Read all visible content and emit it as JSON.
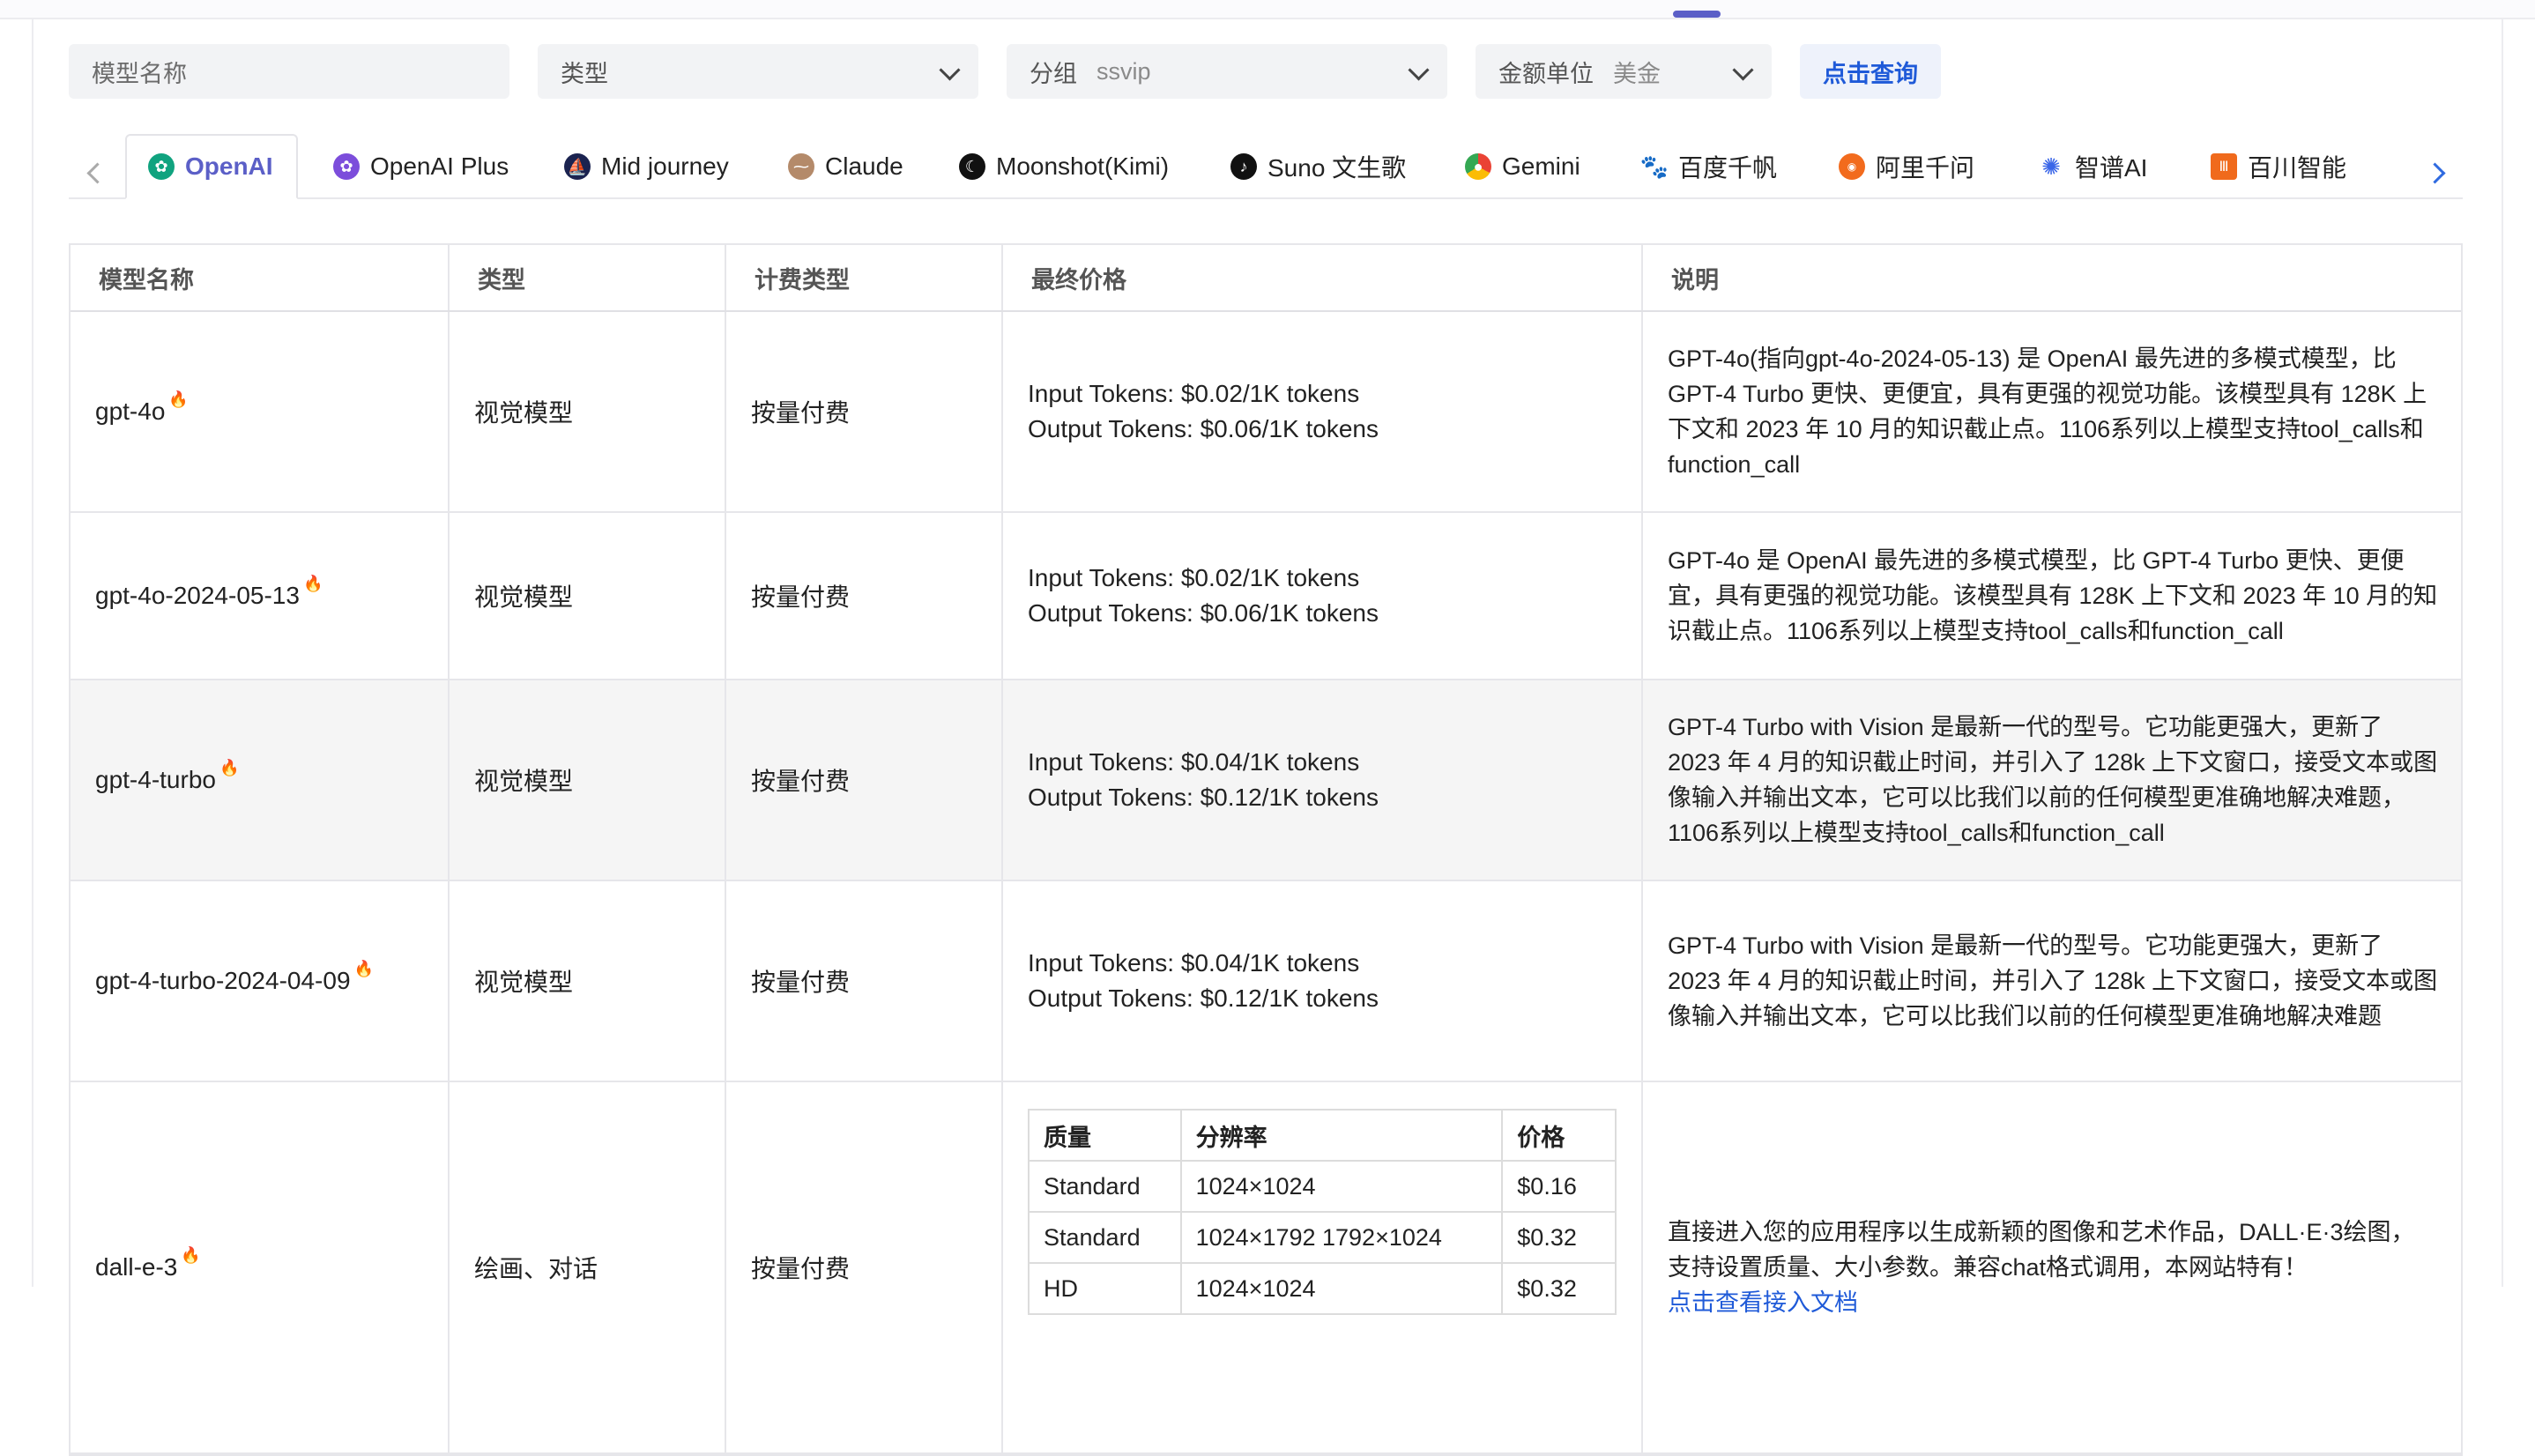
{
  "filters": {
    "model_name_placeholder": "模型名称",
    "type_label": "类型",
    "group_label": "分组",
    "group_value": "ssvip",
    "currency_label": "金额单位",
    "currency_value": "美金",
    "query_button": "点击查询"
  },
  "tabs": [
    {
      "label": "OpenAI",
      "icon": "openai-icon",
      "color": "#10a37f",
      "active": true
    },
    {
      "label": "OpenAI Plus",
      "icon": "openai-plus-icon",
      "color": "#7c4ddb"
    },
    {
      "label": "Mid journey",
      "icon": "midjourney-icon",
      "color": "#1b2350"
    },
    {
      "label": "Claude",
      "icon": "claude-icon",
      "color": "#b48a6a"
    },
    {
      "label": "Moonshot(Kimi)",
      "icon": "moonshot-icon",
      "color": "#111111"
    },
    {
      "label": "Suno 文生歌",
      "icon": "suno-icon",
      "color": "#111111"
    },
    {
      "label": "Gemini",
      "icon": "gemini-icon",
      "color": "#4285f4"
    },
    {
      "label": "百度千帆",
      "icon": "baidu-icon",
      "color": "#2f6ae0"
    },
    {
      "label": "阿里千问",
      "icon": "ali-icon",
      "color": "#f26b1d"
    },
    {
      "label": "智谱AI",
      "icon": "zhipu-icon",
      "color": "#3a66e8"
    },
    {
      "label": "百川智能",
      "icon": "baichuan-icon",
      "color": "#f06a1c"
    }
  ],
  "table": {
    "headers": [
      "模型名称",
      "类型",
      "计费类型",
      "最终价格",
      "说明"
    ],
    "rows": [
      {
        "name": "gpt-4o",
        "type": "视觉模型",
        "billing": "按量付费",
        "price_in": "Input Tokens: $0.02/1K tokens",
        "price_out": "Output Tokens: $0.06/1K tokens",
        "desc": "GPT-4o(指向gpt-4o-2024-05-13) 是 OpenAI 最先进的多模式模型，比 GPT-4 Turbo 更快、更便宜，具有更强的视觉功能。该模型具有 128K 上下文和 2023 年 10 月的知识截止点。1106系列以上模型支持tool_calls和function_call"
      },
      {
        "name": "gpt-4o-2024-05-13",
        "type": "视觉模型",
        "billing": "按量付费",
        "price_in": "Input Tokens: $0.02/1K tokens",
        "price_out": "Output Tokens: $0.06/1K tokens",
        "desc": "GPT-4o 是 OpenAI 最先进的多模式模型，比 GPT-4 Turbo 更快、更便宜，具有更强的视觉功能。该模型具有 128K 上下文和 2023 年 10 月的知识截止点。1106系列以上模型支持tool_calls和function_call"
      },
      {
        "name": "gpt-4-turbo",
        "type": "视觉模型",
        "billing": "按量付费",
        "price_in": "Input Tokens: $0.04/1K tokens",
        "price_out": "Output Tokens: $0.12/1K tokens",
        "desc": "GPT-4 Turbo with Vision 是最新一代的型号。它功能更强大，更新了 2023 年 4 月的知识截止时间，并引入了 128k 上下文窗口，接受文本或图像输入并输出文本，它可以比我们以前的任何模型更准确地解决难题，1106系列以上模型支持tool_calls和function_call"
      },
      {
        "name": "gpt-4-turbo-2024-04-09",
        "type": "视觉模型",
        "billing": "按量付费",
        "price_in": "Input Tokens: $0.04/1K tokens",
        "price_out": "Output Tokens: $0.12/1K tokens",
        "desc": "GPT-4 Turbo with Vision 是最新一代的型号。它功能更强大，更新了 2023 年 4 月的知识截止时间，并引入了 128k 上下文窗口，接受文本或图像输入并输出文本，它可以比我们以前的任何模型更准确地解决难题"
      }
    ],
    "dalle": {
      "name": "dall-e-3",
      "type": "绘画、对话",
      "billing": "按量付费",
      "price_headers": [
        "质量",
        "分辨率",
        "价格"
      ],
      "price_rows": [
        [
          "Standard",
          "1024×1024",
          "$0.16"
        ],
        [
          "Standard",
          "1024×1792 1792×1024",
          "$0.32"
        ],
        [
          "HD",
          "1024×1024",
          "$0.32"
        ]
      ],
      "desc": "直接进入您的应用程序以生成新颖的图像和艺术作品，DALL·E·3绘图，支持设置质量、大小参数。兼容chat格式调用，本网站特有！",
      "doc_link": "点击查看接入文档"
    }
  },
  "fire_glyph": "🔥"
}
